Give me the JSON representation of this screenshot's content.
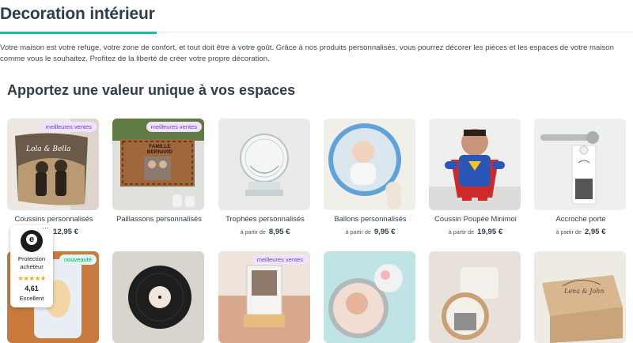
{
  "page": {
    "title": "Decoration intérieur",
    "intro": "Votre maison est votre refuge, votre zone de confort, et tout doit être à votre goût. Grâce à nos produits personnalisés, vous pourrez décorer les pièces et les espaces de votre maison comme vous le souhaitez. Profitez de la liberté de créer votre propre décoration.",
    "section_title": "Apportez une valeur unique à vos espaces"
  },
  "products": [
    {
      "name": "Coussins personnalisés",
      "price_prefix": "",
      "price": "12,95 €",
      "badge": "meilleures ventes"
    },
    {
      "name": "Paillassons personnalisés",
      "price_prefix": "",
      "price": "",
      "badge": "meilleures ventes"
    },
    {
      "name": "Trophées personnalisés",
      "price_prefix": "à partir de",
      "price": "8,95 €",
      "badge": ""
    },
    {
      "name": "Ballons personnalisés",
      "price_prefix": "à partir de",
      "price": "9,95 €",
      "badge": ""
    },
    {
      "name": "Coussin Poupée Minimoi",
      "price_prefix": "à partir de",
      "price": "19,95 €",
      "badge": ""
    },
    {
      "name": "Accroche porte",
      "price_prefix": "à partir de",
      "price": "2,95 €",
      "badge": ""
    }
  ],
  "row2_badges": {
    "candle": "nouveauté",
    "frame": "meilleures ventes"
  },
  "product_art": {
    "doormat_text": "FAMILLE BERNARD",
    "cushion_text": "Lola & Bella",
    "box_text": "Lena & John"
  },
  "trust_badge": {
    "seal": "e",
    "dots": "···",
    "label": "Protection acheteur",
    "stars": "★★★★★",
    "score": "4,61",
    "rating": "Excellent"
  },
  "colors": {
    "accent": "#21b8a6",
    "badge_bg": "#efe3ff",
    "badge_text": "#6a3fc2",
    "new_bg": "#dff7ef",
    "stars": "#f3a71e"
  }
}
